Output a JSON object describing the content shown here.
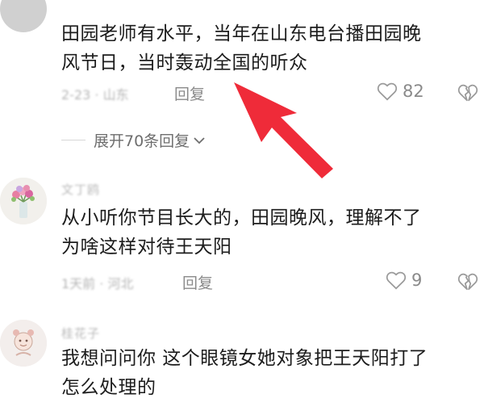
{
  "comments": [
    {
      "username": "",
      "text_line1": "田园老师有水平，当年在山东电台播田园晚",
      "text_line2": "风节日，当时轰动全国的听众",
      "meta": "2-23 · 山东",
      "reply_label": "回复",
      "likes": "82"
    },
    {
      "username": "文丁鸥",
      "text_line1": "从小听你节目长大的，田园晚风，理解不了",
      "text_line2": "为啥这样对待王天阳",
      "meta": "1天前 · 河北",
      "reply_label": "回复",
      "likes": "9"
    },
    {
      "username": "桂花子",
      "text_line1": "我想问问你  这个眼镜女她对象把王天阳打了",
      "text_line2": "怎么处理的",
      "meta": "",
      "reply_label": "",
      "likes": ""
    }
  ],
  "expand_replies_label": "展开70条回复",
  "colors": {
    "arrow": "#ef2b39",
    "muted": "#8a8a8a"
  },
  "icons": [
    "heart-outline-icon",
    "broken-heart-icon",
    "chevron-down-icon"
  ]
}
